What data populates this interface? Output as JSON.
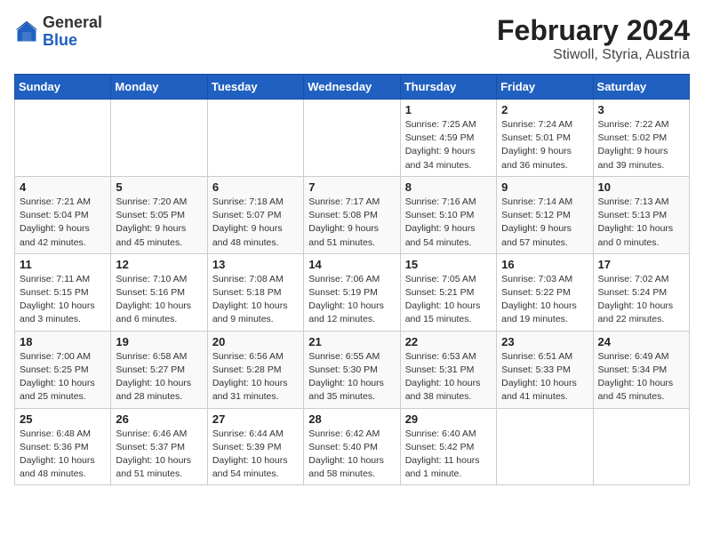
{
  "header": {
    "logo_general": "General",
    "logo_blue": "Blue",
    "title": "February 2024",
    "subtitle": "Stiwoll, Styria, Austria"
  },
  "weekdays": [
    "Sunday",
    "Monday",
    "Tuesday",
    "Wednesday",
    "Thursday",
    "Friday",
    "Saturday"
  ],
  "weeks": [
    [
      {
        "day": "",
        "info": ""
      },
      {
        "day": "",
        "info": ""
      },
      {
        "day": "",
        "info": ""
      },
      {
        "day": "",
        "info": ""
      },
      {
        "day": "1",
        "info": "Sunrise: 7:25 AM\nSunset: 4:59 PM\nDaylight: 9 hours\nand 34 minutes."
      },
      {
        "day": "2",
        "info": "Sunrise: 7:24 AM\nSunset: 5:01 PM\nDaylight: 9 hours\nand 36 minutes."
      },
      {
        "day": "3",
        "info": "Sunrise: 7:22 AM\nSunset: 5:02 PM\nDaylight: 9 hours\nand 39 minutes."
      }
    ],
    [
      {
        "day": "4",
        "info": "Sunrise: 7:21 AM\nSunset: 5:04 PM\nDaylight: 9 hours\nand 42 minutes."
      },
      {
        "day": "5",
        "info": "Sunrise: 7:20 AM\nSunset: 5:05 PM\nDaylight: 9 hours\nand 45 minutes."
      },
      {
        "day": "6",
        "info": "Sunrise: 7:18 AM\nSunset: 5:07 PM\nDaylight: 9 hours\nand 48 minutes."
      },
      {
        "day": "7",
        "info": "Sunrise: 7:17 AM\nSunset: 5:08 PM\nDaylight: 9 hours\nand 51 minutes."
      },
      {
        "day": "8",
        "info": "Sunrise: 7:16 AM\nSunset: 5:10 PM\nDaylight: 9 hours\nand 54 minutes."
      },
      {
        "day": "9",
        "info": "Sunrise: 7:14 AM\nSunset: 5:12 PM\nDaylight: 9 hours\nand 57 minutes."
      },
      {
        "day": "10",
        "info": "Sunrise: 7:13 AM\nSunset: 5:13 PM\nDaylight: 10 hours\nand 0 minutes."
      }
    ],
    [
      {
        "day": "11",
        "info": "Sunrise: 7:11 AM\nSunset: 5:15 PM\nDaylight: 10 hours\nand 3 minutes."
      },
      {
        "day": "12",
        "info": "Sunrise: 7:10 AM\nSunset: 5:16 PM\nDaylight: 10 hours\nand 6 minutes."
      },
      {
        "day": "13",
        "info": "Sunrise: 7:08 AM\nSunset: 5:18 PM\nDaylight: 10 hours\nand 9 minutes."
      },
      {
        "day": "14",
        "info": "Sunrise: 7:06 AM\nSunset: 5:19 PM\nDaylight: 10 hours\nand 12 minutes."
      },
      {
        "day": "15",
        "info": "Sunrise: 7:05 AM\nSunset: 5:21 PM\nDaylight: 10 hours\nand 15 minutes."
      },
      {
        "day": "16",
        "info": "Sunrise: 7:03 AM\nSunset: 5:22 PM\nDaylight: 10 hours\nand 19 minutes."
      },
      {
        "day": "17",
        "info": "Sunrise: 7:02 AM\nSunset: 5:24 PM\nDaylight: 10 hours\nand 22 minutes."
      }
    ],
    [
      {
        "day": "18",
        "info": "Sunrise: 7:00 AM\nSunset: 5:25 PM\nDaylight: 10 hours\nand 25 minutes."
      },
      {
        "day": "19",
        "info": "Sunrise: 6:58 AM\nSunset: 5:27 PM\nDaylight: 10 hours\nand 28 minutes."
      },
      {
        "day": "20",
        "info": "Sunrise: 6:56 AM\nSunset: 5:28 PM\nDaylight: 10 hours\nand 31 minutes."
      },
      {
        "day": "21",
        "info": "Sunrise: 6:55 AM\nSunset: 5:30 PM\nDaylight: 10 hours\nand 35 minutes."
      },
      {
        "day": "22",
        "info": "Sunrise: 6:53 AM\nSunset: 5:31 PM\nDaylight: 10 hours\nand 38 minutes."
      },
      {
        "day": "23",
        "info": "Sunrise: 6:51 AM\nSunset: 5:33 PM\nDaylight: 10 hours\nand 41 minutes."
      },
      {
        "day": "24",
        "info": "Sunrise: 6:49 AM\nSunset: 5:34 PM\nDaylight: 10 hours\nand 45 minutes."
      }
    ],
    [
      {
        "day": "25",
        "info": "Sunrise: 6:48 AM\nSunset: 5:36 PM\nDaylight: 10 hours\nand 48 minutes."
      },
      {
        "day": "26",
        "info": "Sunrise: 6:46 AM\nSunset: 5:37 PM\nDaylight: 10 hours\nand 51 minutes."
      },
      {
        "day": "27",
        "info": "Sunrise: 6:44 AM\nSunset: 5:39 PM\nDaylight: 10 hours\nand 54 minutes."
      },
      {
        "day": "28",
        "info": "Sunrise: 6:42 AM\nSunset: 5:40 PM\nDaylight: 10 hours\nand 58 minutes."
      },
      {
        "day": "29",
        "info": "Sunrise: 6:40 AM\nSunset: 5:42 PM\nDaylight: 11 hours\nand 1 minute."
      },
      {
        "day": "",
        "info": ""
      },
      {
        "day": "",
        "info": ""
      }
    ]
  ]
}
